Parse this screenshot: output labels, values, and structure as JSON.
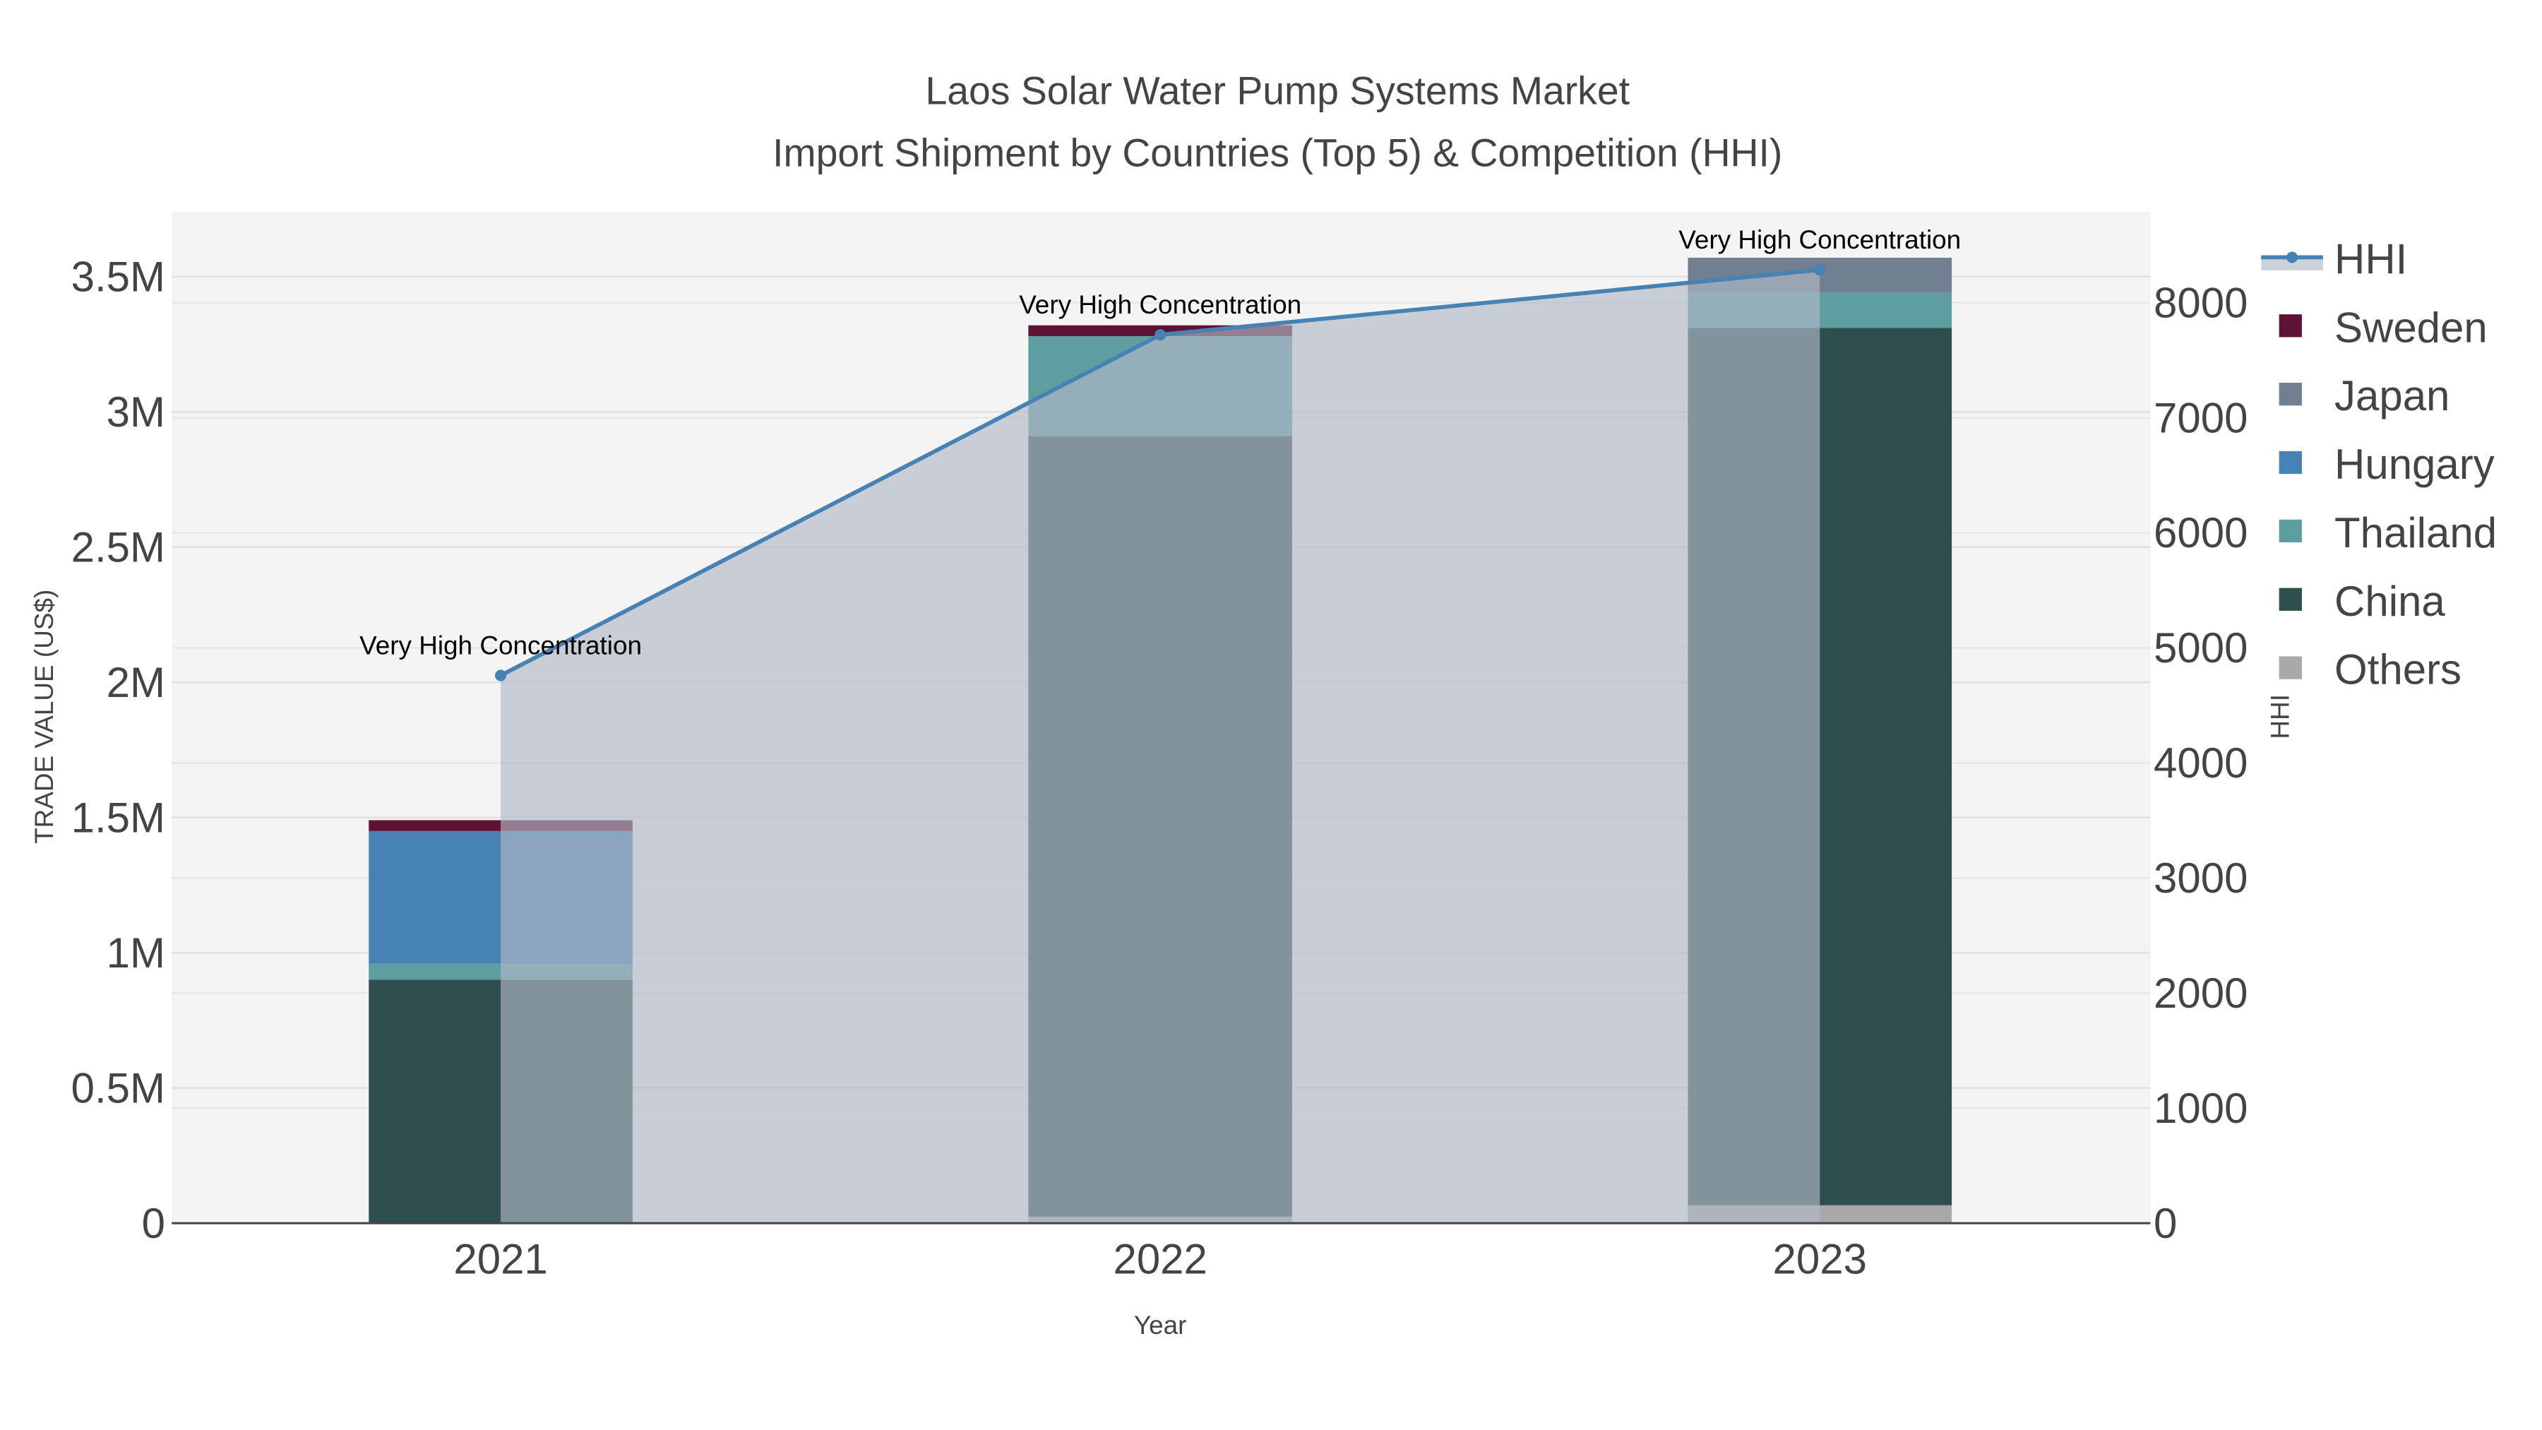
{
  "chart_data": {
    "type": "bar",
    "title": "Laos Solar Water Pump Systems Market",
    "subtitle": "Import Shipment by Countries (Top 5) & Competition (HHI)",
    "xlabel": "Year",
    "ylabel": "TRADE VALUE (US$)",
    "y2label": "HHI",
    "categories": [
      "2021",
      "2022",
      "2023"
    ],
    "ylim": [
      0,
      3740000
    ],
    "y2lim": [
      0,
      8790
    ],
    "yticks": [
      {
        "v": 0,
        "t": "0"
      },
      {
        "v": 500000,
        "t": "0.5M"
      },
      {
        "v": 1000000,
        "t": "1M"
      },
      {
        "v": 1500000,
        "t": "1.5M"
      },
      {
        "v": 2000000,
        "t": "2M"
      },
      {
        "v": 2500000,
        "t": "2.5M"
      },
      {
        "v": 3000000,
        "t": "3M"
      },
      {
        "v": 3500000,
        "t": "3.5M"
      }
    ],
    "y2ticks": [
      {
        "v": 0,
        "t": "0"
      },
      {
        "v": 1000,
        "t": "1000"
      },
      {
        "v": 2000,
        "t": "2000"
      },
      {
        "v": 3000,
        "t": "3000"
      },
      {
        "v": 4000,
        "t": "4000"
      },
      {
        "v": 5000,
        "t": "5000"
      },
      {
        "v": 6000,
        "t": "6000"
      },
      {
        "v": 7000,
        "t": "7000"
      },
      {
        "v": 8000,
        "t": "8000"
      }
    ],
    "series": [
      {
        "name": "Others",
        "color": "#a9a9a9",
        "values": [
          0,
          24000,
          66000
        ]
      },
      {
        "name": "China",
        "color": "#2f4f4f",
        "values": [
          900000,
          2886000,
          3244000
        ]
      },
      {
        "name": "Thailand",
        "color": "#5f9ea0",
        "values": [
          60000,
          370000,
          130000
        ]
      },
      {
        "name": "Hungary",
        "color": "#4682b4",
        "values": [
          490000,
          0,
          0
        ]
      },
      {
        "name": "Japan",
        "color": "#708090",
        "values": [
          0,
          0,
          130000
        ]
      },
      {
        "name": "Sweden",
        "color": "#5e1236",
        "values": [
          40000,
          40000,
          0
        ]
      }
    ],
    "hhi": {
      "name": "HHI",
      "color": "#4682b4",
      "values": [
        4760,
        7720,
        8285
      ]
    },
    "annotations": [
      "Very High Concentration",
      "Very High Concentration",
      "Very High Concentration"
    ],
    "legend_order": [
      "HHI",
      "Sweden",
      "Japan",
      "Hungary",
      "Thailand",
      "China",
      "Others"
    ],
    "legend_placement": "right"
  }
}
